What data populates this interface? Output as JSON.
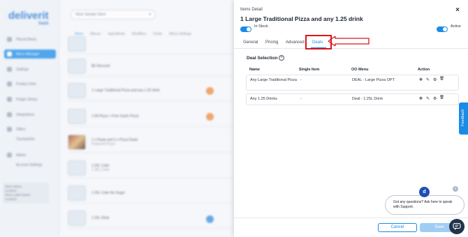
{
  "background": {
    "logo": "deliverit",
    "logo_sub": "SaaS",
    "nav_items": [
      "Placed Menu",
      "Menu Manager",
      "Settings",
      "Product Sets",
      "Image Library",
      "Integrations",
      "Offers",
      "Touchpoints",
      "Admin",
      "Account Settings"
    ],
    "store_lines": [
      "Store Name",
      "Location",
      "Store Label Name",
      "Location"
    ],
    "store_select": "Store Sample Store",
    "tabs": [
      "Items",
      "Menus",
      "Ingredients",
      "Modifiers",
      "Deals",
      "Menu Settings"
    ],
    "rows": [
      {
        "name": "",
        "sub": ""
      },
      {
        "name": "$5 Discount",
        "sub": ""
      },
      {
        "name": "1 Large Traditional Pizza and any 1.25 drink",
        "sub": ""
      },
      {
        "name": "1.99 Pizza + Free Garlic Pizza",
        "sub": ""
      },
      {
        "name": "1 x Pasta and 2 x Pizza Deals",
        "sub": "Featured Pizza"
      },
      {
        "name": "1.25L Coke",
        "sub": "1.25L Coke"
      },
      {
        "name": "1.25L Coke No Sugar",
        "sub": ""
      },
      {
        "name": "1.25L Drink",
        "sub": ""
      }
    ]
  },
  "drawer": {
    "label": "Items Detail",
    "title": "1 Large Traditional Pizza and any 1.25 drink",
    "in_stock_label": "In Stock",
    "active_label": "Active",
    "close": "×",
    "tabs": [
      "General",
      "Pricing",
      "Advanced",
      "Deals"
    ],
    "active_tab": "Deals",
    "section_title": "Deal Selection",
    "add": "+",
    "columns": [
      "Name",
      "Single Item",
      "OO Menu",
      "Action"
    ],
    "rows": [
      {
        "name": "Any Large Traditional Pizza",
        "single": "-",
        "oo_menu": "DEAL - Large Pizza OPT"
      },
      {
        "name": "Any 1.25 Drinks",
        "single": "-",
        "oo_menu": "Deal - 1.25L Drink"
      }
    ],
    "actions": {
      "move": "✥",
      "edit": "✎",
      "settings": "⚙",
      "delete": "🗑"
    },
    "cancel": "Cancel",
    "save": "Save"
  },
  "feedback": "Feedback",
  "support": {
    "avatar": "d",
    "message": "Got any questions? Ask here to speak with Support.",
    "close": "×"
  },
  "colors": {
    "accent": "#1a8be6",
    "highlight": "#d9161e"
  }
}
